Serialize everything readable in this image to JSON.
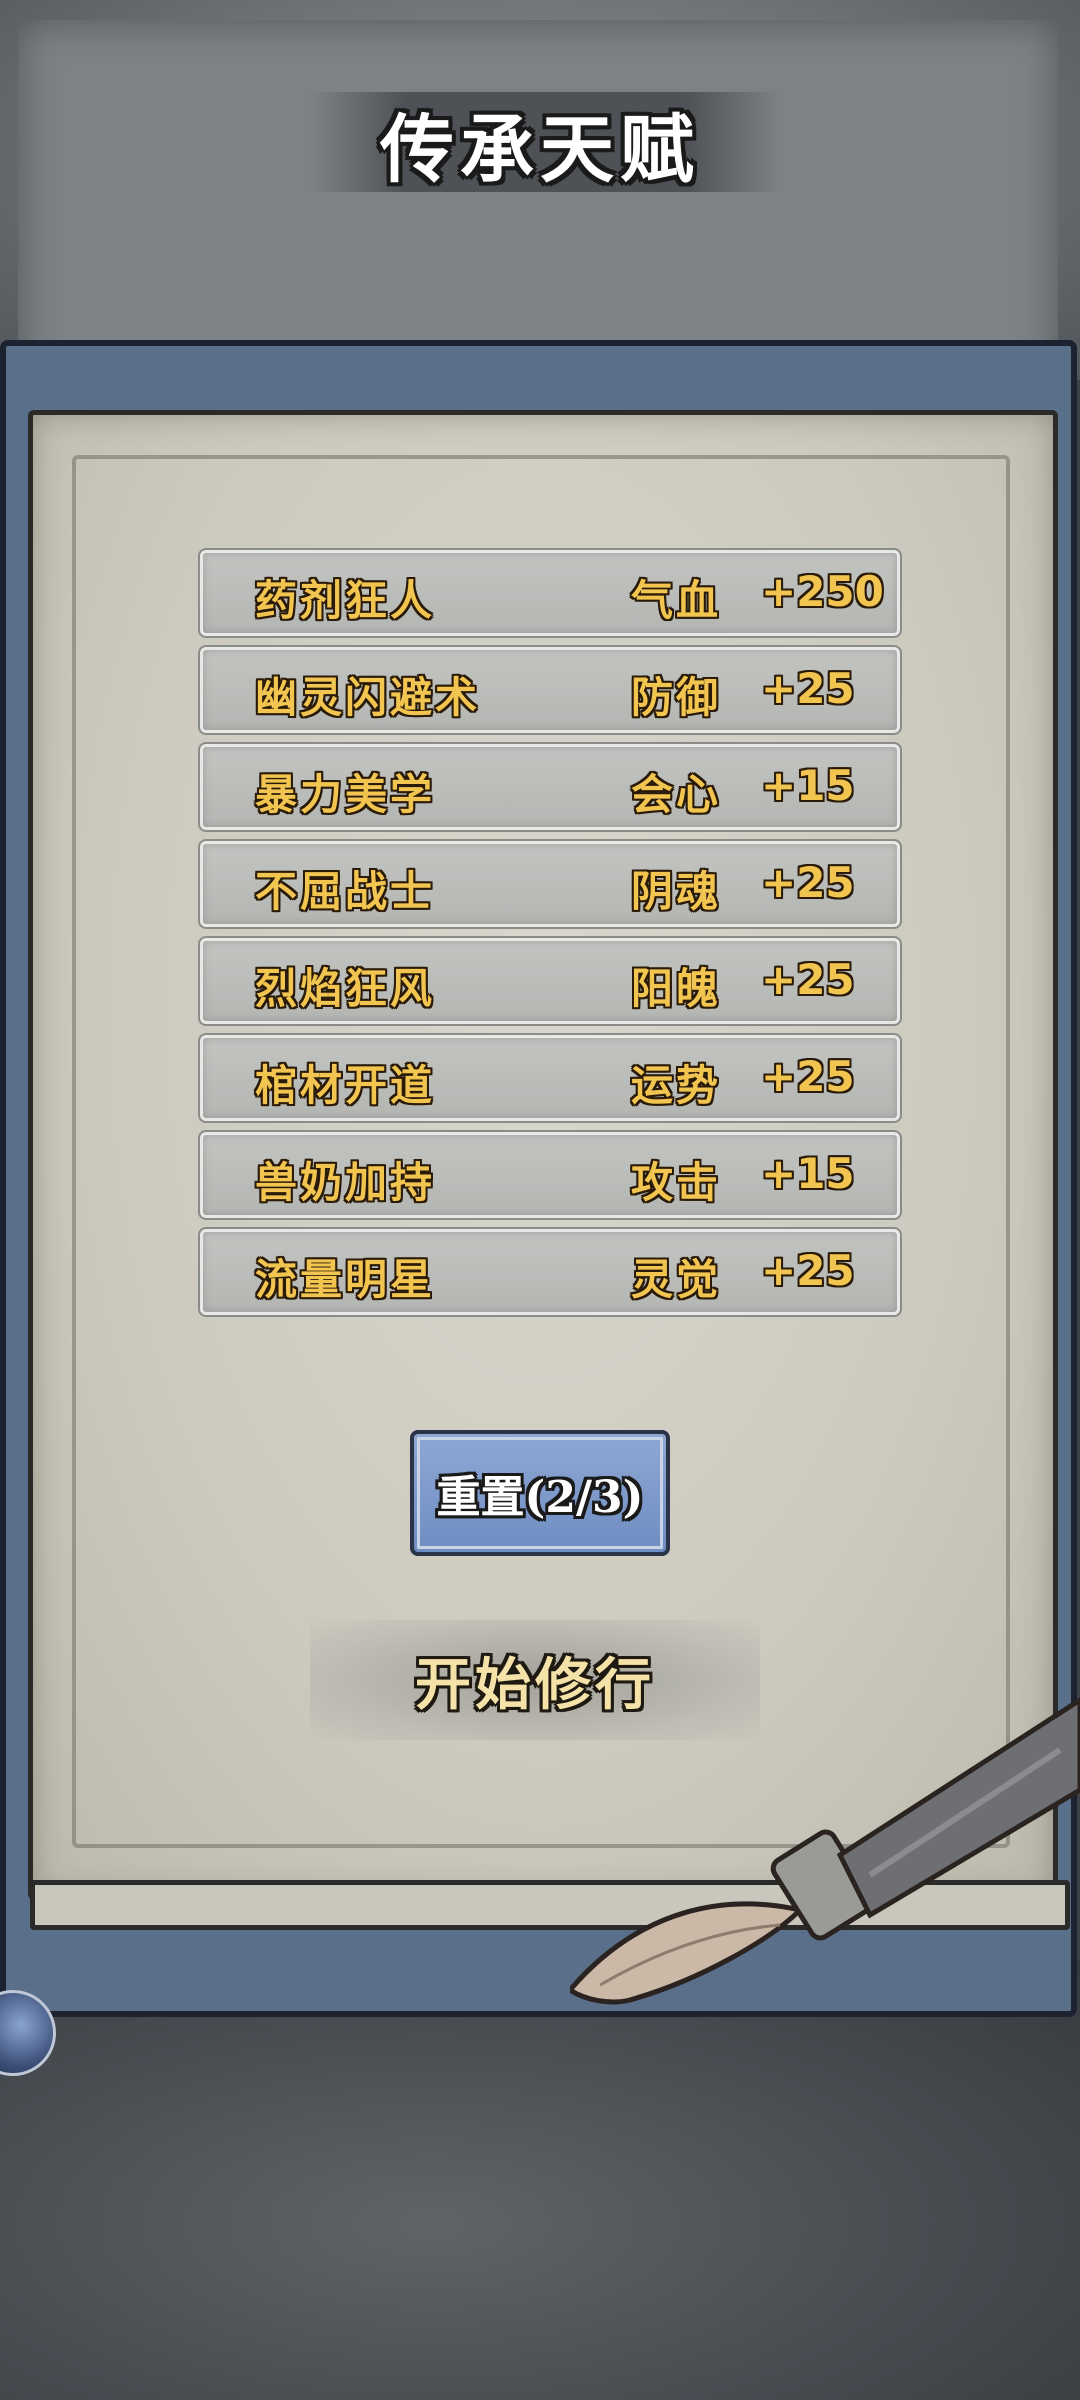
{
  "header": {
    "title": "传承天赋"
  },
  "talents": [
    {
      "name": "药剂狂人",
      "stat": "气血",
      "value": "+250"
    },
    {
      "name": "幽灵闪避术",
      "stat": "防御",
      "value": "+25"
    },
    {
      "name": "暴力美学",
      "stat": "会心",
      "value": "+15"
    },
    {
      "name": "不屈战士",
      "stat": "阴魂",
      "value": "+25"
    },
    {
      "name": "烈焰狂风",
      "stat": "阳魄",
      "value": "+25"
    },
    {
      "name": "棺材开道",
      "stat": "运势",
      "value": "+25"
    },
    {
      "name": "兽奶加持",
      "stat": "攻击",
      "value": "+15"
    },
    {
      "name": "流量明星",
      "stat": "灵觉",
      "value": "+25"
    }
  ],
  "actions": {
    "reset_label": "重置(2/3)",
    "start_label": "开始修行"
  },
  "colors": {
    "talent_text": "#f2c550",
    "reset_button": "#7f9bcb",
    "scroll_backing": "#5a6f8a",
    "paper": "#d0cdc2"
  }
}
